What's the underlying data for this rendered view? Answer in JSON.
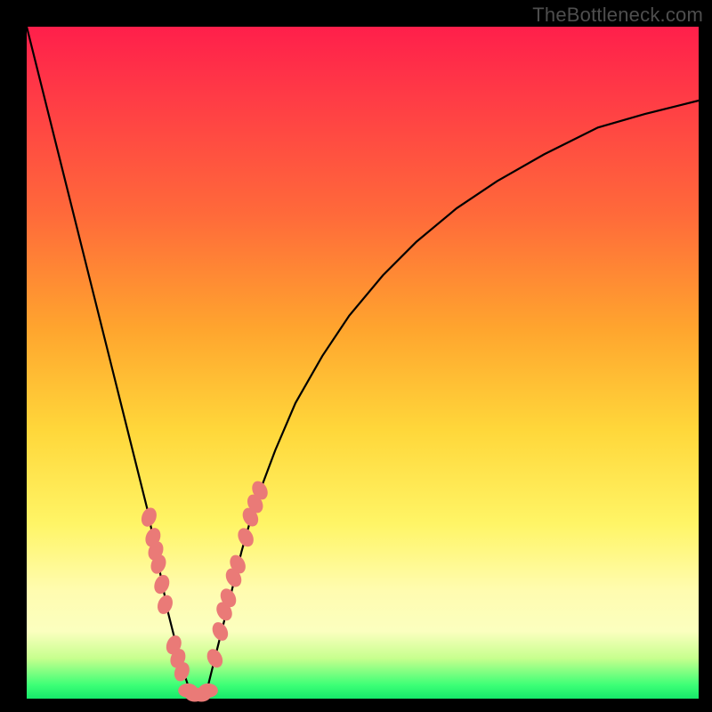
{
  "watermark": "TheBottleneck.com",
  "chart_data": {
    "type": "line",
    "title": "",
    "xlabel": "",
    "ylabel": "",
    "xlim": [
      0,
      100
    ],
    "ylim": [
      0,
      100
    ],
    "series": [
      {
        "name": "bottleneck-curve",
        "x": [
          0,
          2,
          4,
          6,
          8,
          10,
          12,
          14,
          16,
          18,
          20,
          21,
          22,
          23,
          24,
          25,
          26,
          27,
          28,
          30,
          32,
          34,
          37,
          40,
          44,
          48,
          53,
          58,
          64,
          70,
          77,
          85,
          92,
          100
        ],
        "values": [
          100,
          92,
          84,
          76,
          68,
          60,
          52,
          44,
          36,
          28,
          18,
          13,
          9,
          5,
          2,
          0,
          0,
          2,
          6,
          14,
          22,
          29,
          37,
          44,
          51,
          57,
          63,
          68,
          73,
          77,
          81,
          85,
          87,
          89
        ]
      }
    ],
    "markers": [
      {
        "name": "left-cluster",
        "color": "#ea7a77",
        "points": [
          {
            "x": 18.2,
            "y": 27
          },
          {
            "x": 18.8,
            "y": 24
          },
          {
            "x": 19.2,
            "y": 22
          },
          {
            "x": 19.6,
            "y": 20
          },
          {
            "x": 20.1,
            "y": 17
          },
          {
            "x": 20.6,
            "y": 14
          },
          {
            "x": 21.9,
            "y": 8
          },
          {
            "x": 22.5,
            "y": 6
          },
          {
            "x": 23.1,
            "y": 4
          }
        ]
      },
      {
        "name": "trough-cluster",
        "color": "#ea7a77",
        "points": [
          {
            "x": 24.0,
            "y": 1.2
          },
          {
            "x": 25.0,
            "y": 0.6
          },
          {
            "x": 26.0,
            "y": 0.6
          },
          {
            "x": 27.0,
            "y": 1.2
          }
        ]
      },
      {
        "name": "right-cluster",
        "color": "#ea7a77",
        "points": [
          {
            "x": 28.0,
            "y": 6
          },
          {
            "x": 28.8,
            "y": 10
          },
          {
            "x": 29.4,
            "y": 13
          },
          {
            "x": 30.0,
            "y": 15
          },
          {
            "x": 30.8,
            "y": 18
          },
          {
            "x": 31.4,
            "y": 20
          },
          {
            "x": 32.6,
            "y": 24
          },
          {
            "x": 33.3,
            "y": 27
          },
          {
            "x": 34.0,
            "y": 29
          },
          {
            "x": 34.7,
            "y": 31
          }
        ]
      }
    ]
  }
}
